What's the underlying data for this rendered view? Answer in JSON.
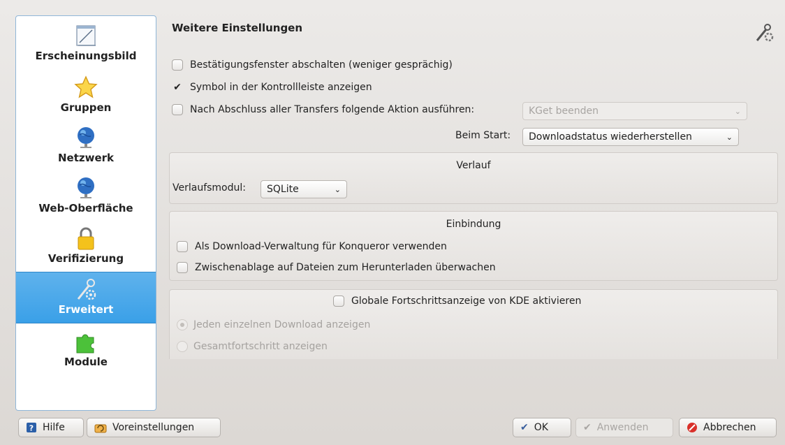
{
  "sidebar": {
    "items": [
      {
        "label": "Erscheinungsbild",
        "icon": "appearance-icon"
      },
      {
        "label": "Gruppen",
        "icon": "star-icon"
      },
      {
        "label": "Netzwerk",
        "icon": "globe-icon"
      },
      {
        "label": "Web-Oberfläche",
        "icon": "globe-icon"
      },
      {
        "label": "Verifizierung",
        "icon": "lock-icon"
      },
      {
        "label": "Erweitert",
        "icon": "tools-icon",
        "active": true
      },
      {
        "label": "Module",
        "icon": "puzzle-icon"
      }
    ]
  },
  "main": {
    "title": "Weitere Einstellungen",
    "opt_disable_confirm": "Bestätigungsfenster abschalten (weniger gesprächig)",
    "opt_tray_icon": "Symbol in der Kontrollleiste anzeigen",
    "opt_after_finish": "Nach Abschluss aller Transfers folgende Aktion ausführen:",
    "after_finish_value": "KGet beenden",
    "on_start_label": "Beim Start:",
    "on_start_value": "Downloadstatus wiederherstellen",
    "history": {
      "title": "Verlauf",
      "backend_label": "Verlaufsmodul:",
      "backend_value": "SQLite"
    },
    "integration": {
      "title": "Einbindung",
      "opt_konqueror": "Als Download-Verwaltung für Konqueror verwenden",
      "opt_clipboard": "Zwischenablage auf Dateien zum Herunterladen überwachen"
    },
    "progress": {
      "opt_global": "Globale Fortschrittsanzeige von KDE aktivieren",
      "opt_each": "Jeden einzelnen Download anzeigen",
      "opt_total": "Gesamtfortschritt anzeigen"
    }
  },
  "buttons": {
    "help": "Hilfe",
    "defaults": "Voreinstellungen",
    "ok": "OK",
    "apply": "Anwenden",
    "cancel": "Abbrechen"
  },
  "colors": {
    "accent": "#3aa0e8",
    "cancel_red": "#d9302a"
  }
}
